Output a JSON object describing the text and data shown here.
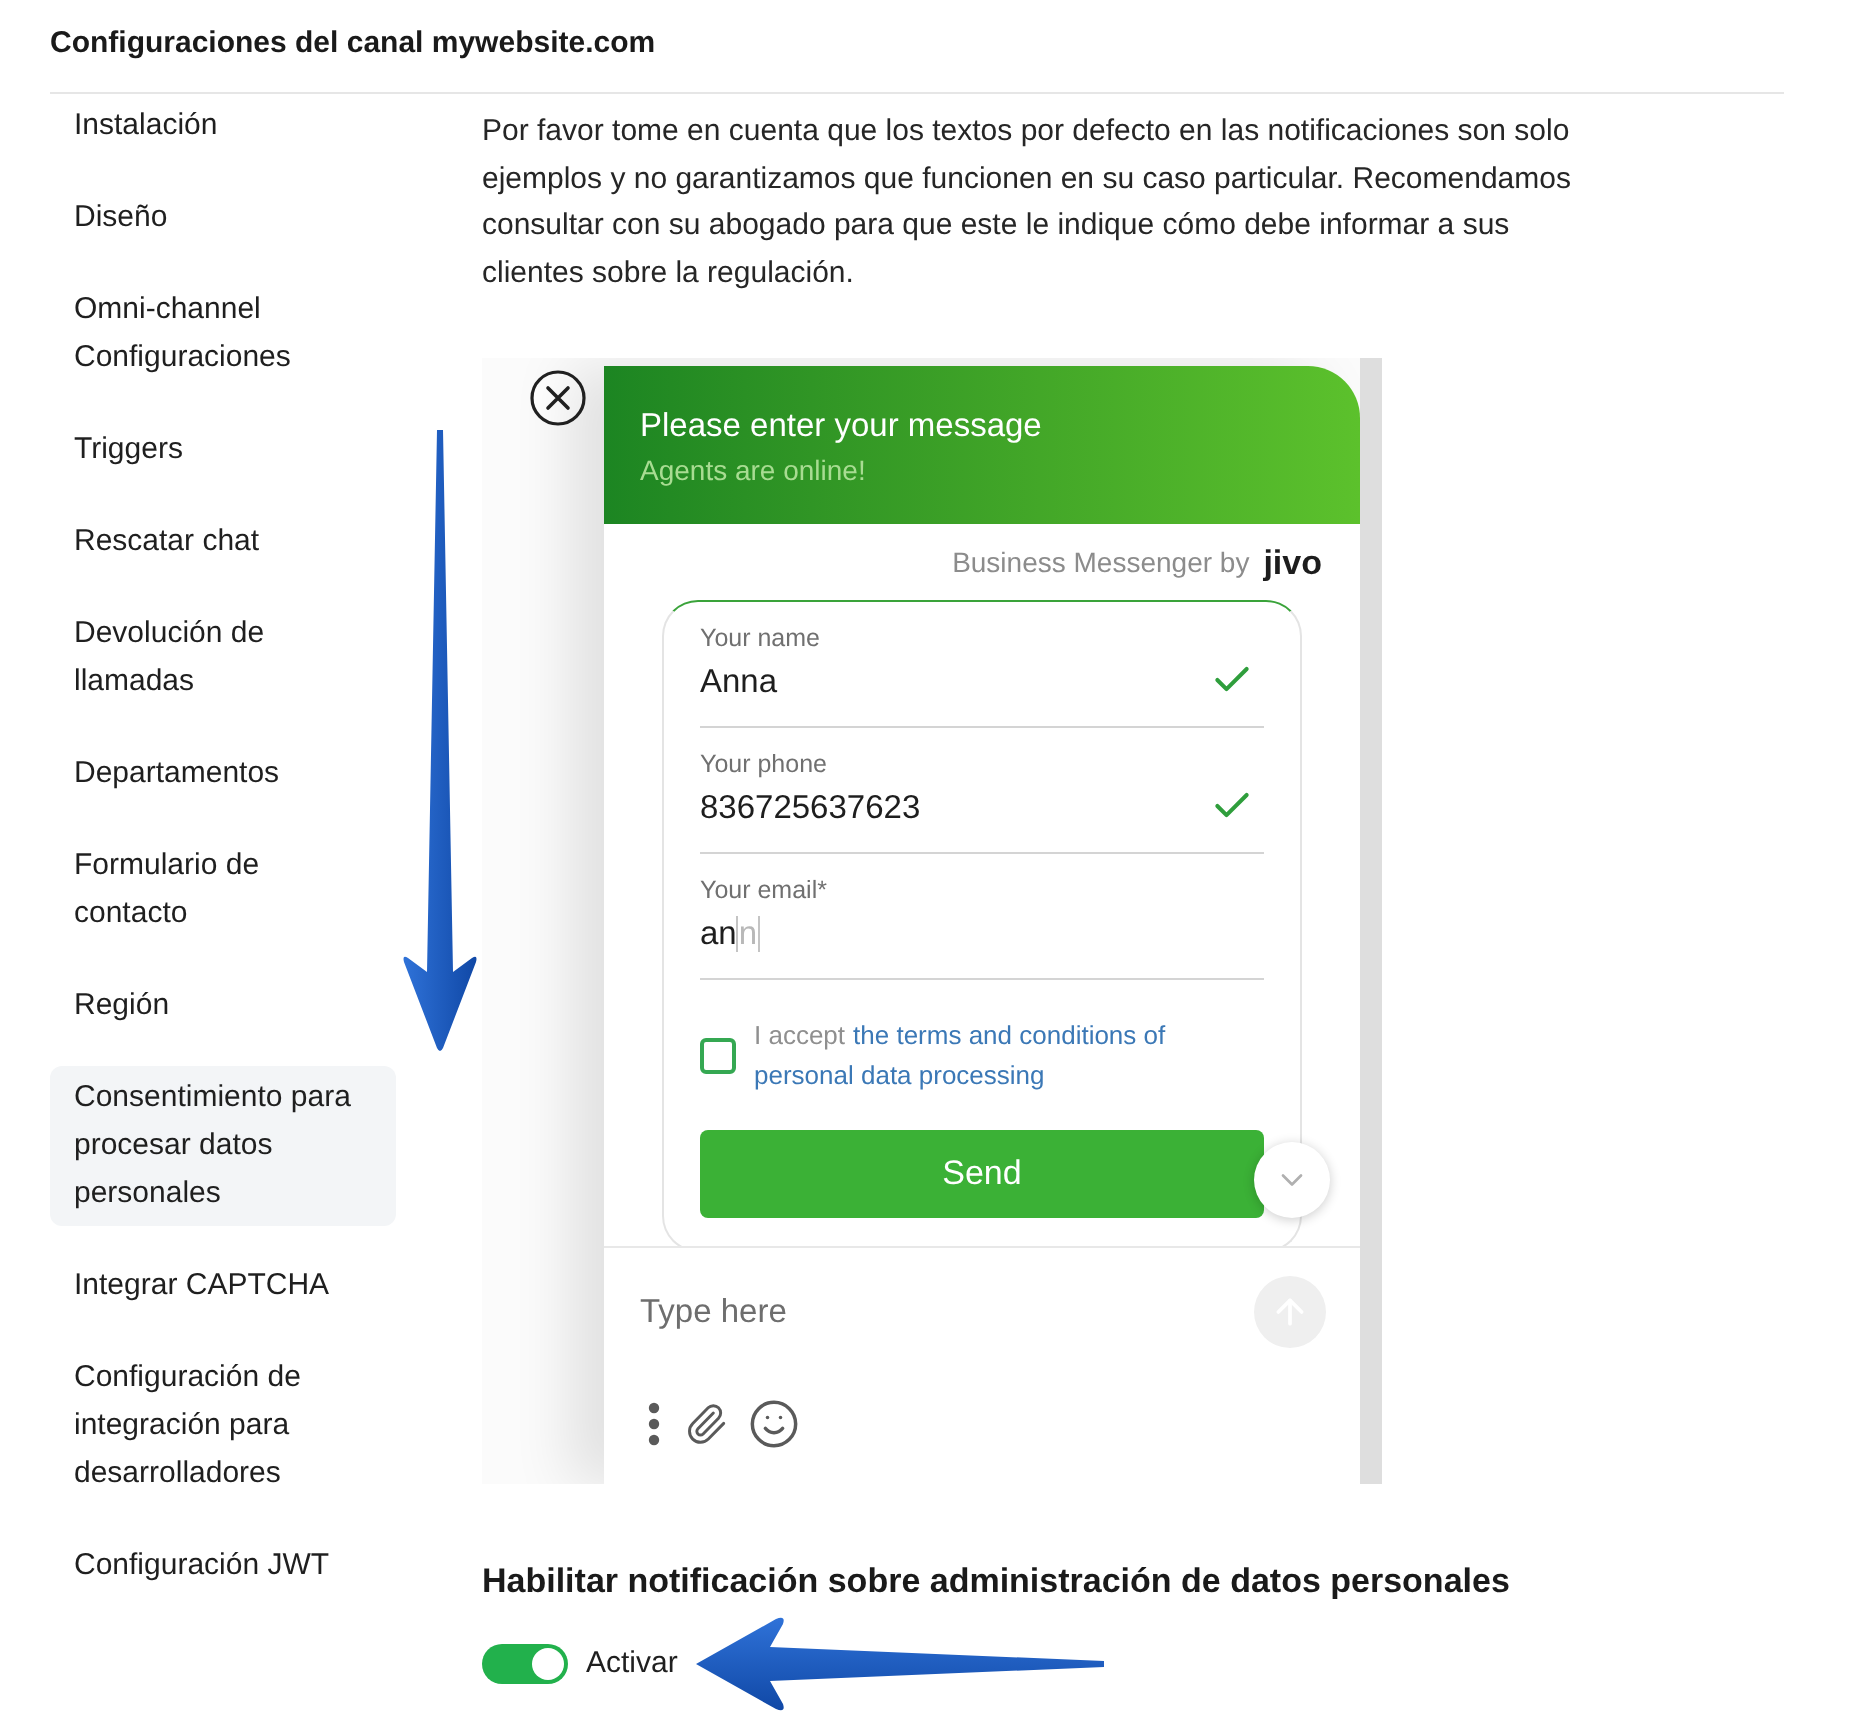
{
  "page": {
    "title": "Configuraciones del canal mywebsite.com"
  },
  "sidebar": {
    "items": [
      {
        "label": "Instalación",
        "selected": false
      },
      {
        "label": "Diseño",
        "selected": false
      },
      {
        "label": "Omni-channel Configuraciones",
        "selected": false
      },
      {
        "label": "Triggers",
        "selected": false
      },
      {
        "label": "Rescatar chat",
        "selected": false
      },
      {
        "label": "Devolución de llamadas",
        "selected": false
      },
      {
        "label": "Departamentos",
        "selected": false
      },
      {
        "label": "Formulario de contacto",
        "selected": false
      },
      {
        "label": "Región",
        "selected": false
      },
      {
        "label": "Consentimiento para procesar datos personales",
        "selected": true
      },
      {
        "label": "Integrar CAPTCHA",
        "selected": false
      },
      {
        "label": "Configuración de integración para desarrolladores",
        "selected": false
      },
      {
        "label": "Configuración JWT",
        "selected": false
      }
    ]
  },
  "content": {
    "notice": "Por favor tome en cuenta que los textos por defecto en las notificaciones son solo ejemplos y no garantizamos que funcionen en su caso particular. Recomendamos consultar con su abogado para que este le indique cómo debe informar a sus clientes sobre la regulación.",
    "widget_preview": {
      "header": {
        "title": "Please enter your message",
        "subtitle": "Agents are online!"
      },
      "branding": {
        "caption": "Business Messenger by",
        "logo": "jivo"
      },
      "fields": [
        {
          "label": "Your name",
          "value": "Anna",
          "valid": true
        },
        {
          "label": "Your phone",
          "value": "836725637623",
          "valid": true
        },
        {
          "label": "Your email*",
          "value": "an",
          "suggestion": "n",
          "valid": false
        }
      ],
      "consent": {
        "checked": false,
        "prefix": "I accept",
        "link": "the terms and conditions of personal data processing"
      },
      "send_button": "Send",
      "message_input": {
        "placeholder": "Type here"
      }
    },
    "notification_setting": {
      "heading": "Habilitar notificación sobre administración de datos personales",
      "toggle": {
        "label": "Activar",
        "on": true
      }
    }
  }
}
